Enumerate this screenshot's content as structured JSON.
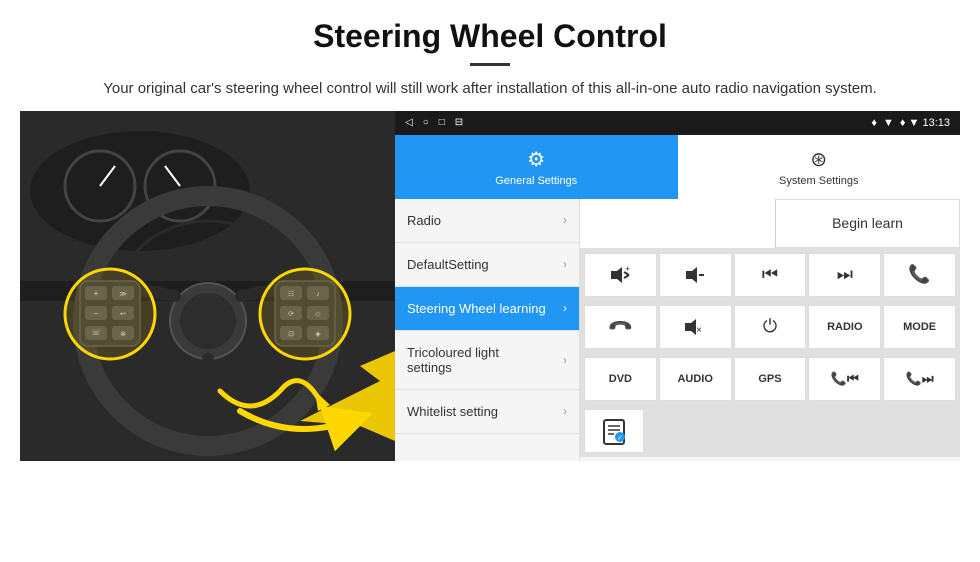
{
  "header": {
    "title": "Steering Wheel Control",
    "subtitle": "Your original car's steering wheel control will still work after installation of this all-in-one auto radio navigation system."
  },
  "status_bar": {
    "icons": [
      "◁",
      "○",
      "□",
      "⊟"
    ],
    "right": "♦ ▼ 13:13"
  },
  "tabs": {
    "general": "General Settings",
    "system": "System Settings"
  },
  "menu": {
    "items": [
      {
        "label": "Radio",
        "active": false
      },
      {
        "label": "DefaultSetting",
        "active": false
      },
      {
        "label": "Steering Wheel learning",
        "active": true
      },
      {
        "label": "Tricoloured light settings",
        "active": false
      },
      {
        "label": "Whitelist setting",
        "active": false
      }
    ]
  },
  "controls": {
    "begin_learn": "Begin learn",
    "buttons_row1": [
      "🔊+",
      "🔊−",
      "⏮",
      "⏭",
      "📞"
    ],
    "buttons_row2": [
      "↩",
      "🔇",
      "⏻",
      "RADIO",
      "MODE"
    ],
    "buttons_row3": [
      "DVD",
      "AUDIO",
      "GPS",
      "📞⏮",
      "📞⏭"
    ]
  }
}
